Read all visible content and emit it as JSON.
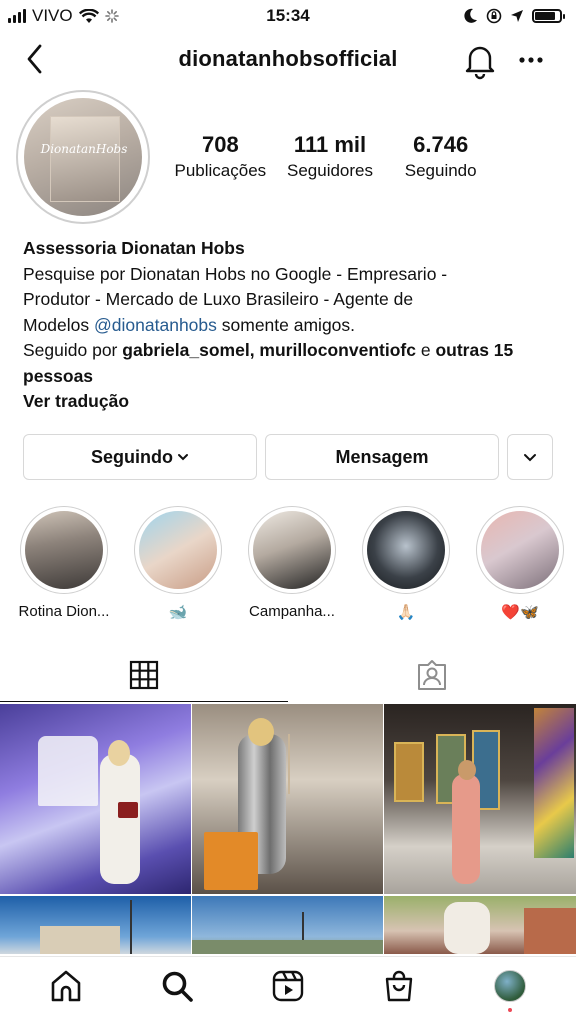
{
  "status_bar": {
    "carrier": "VIVO",
    "time": "15:34",
    "battery_level": 0.85
  },
  "header": {
    "username": "dionatanhobsofficial",
    "icons": {
      "back": "chevron-left-icon",
      "notifications": "bell-icon",
      "more": "more-horizontal-icon"
    }
  },
  "profile": {
    "avatar_logo_text": "DionatanHobs",
    "stats": [
      {
        "value": "708",
        "label": "Publicações"
      },
      {
        "value": "111 mil",
        "label": "Seguidores"
      },
      {
        "value": "6.746",
        "label": "Seguindo"
      }
    ],
    "display_name": "Assessoria Dionatan Hobs",
    "bio_line_1": "Pesquise por Dionatan Hobs no Google - Empresario -",
    "bio_line_2": "Produtor - Mercado de Luxo Brasileiro - Agente de",
    "bio_line_3_prefix": "Modelos",
    "bio_mention": "@dionatanhobs",
    "bio_line_3_suffix": "somente amigos.",
    "followed_by_prefix": "Seguido por",
    "followed_by_users": "gabriela_somel, murilloconventiofc",
    "followed_by_and": "e",
    "followed_by_others": "outras 15 pessoas",
    "translate_link": "Ver tradução"
  },
  "actions": {
    "following_label": "Seguindo",
    "message_label": "Mensagem"
  },
  "highlights": [
    {
      "label": "Rotina Dion..."
    },
    {
      "label": "🐋"
    },
    {
      "label": "Campanha..."
    },
    {
      "label": "🙏🏻"
    },
    {
      "label": "❤️🦋"
    }
  ],
  "tabs": [
    {
      "icon": "grid-icon",
      "active": true
    },
    {
      "icon": "tagged-user-icon",
      "active": false
    }
  ],
  "bottom_nav": [
    {
      "icon": "home-icon"
    },
    {
      "icon": "search-icon"
    },
    {
      "icon": "reels-icon"
    },
    {
      "icon": "shop-bag-icon"
    },
    {
      "icon": "profile-avatar-icon"
    }
  ]
}
